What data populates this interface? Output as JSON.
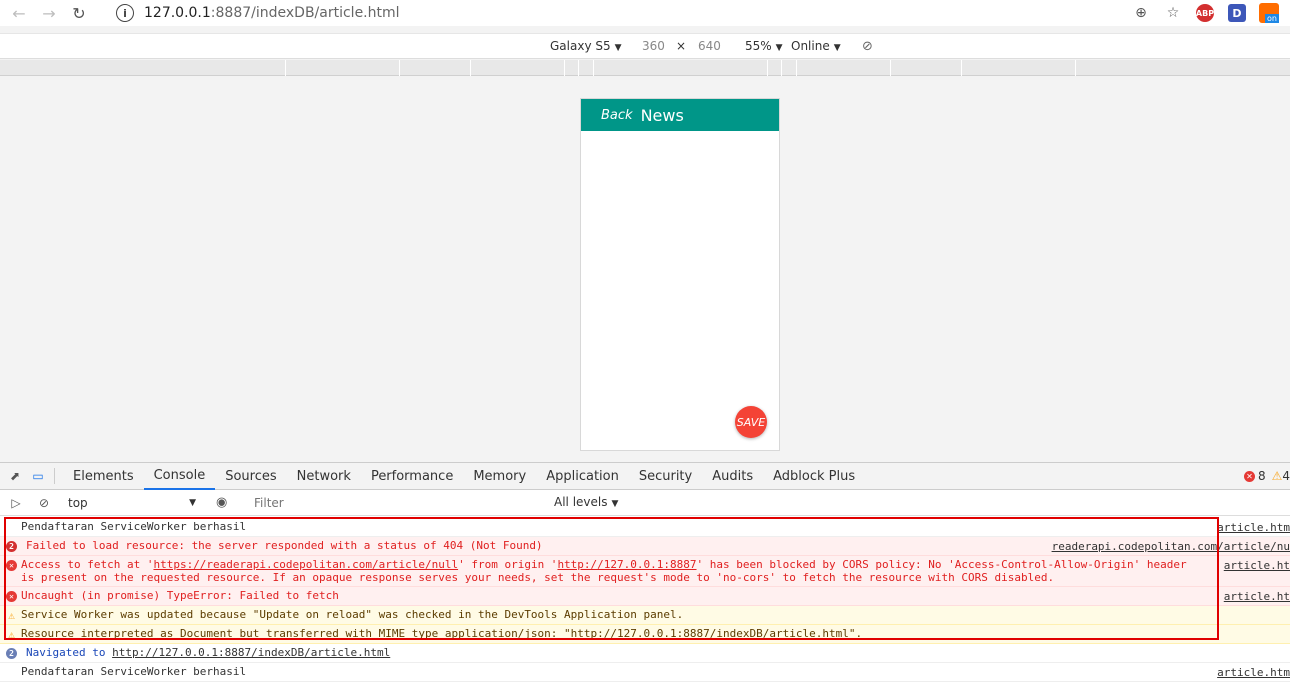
{
  "browser": {
    "url_host": "127.0.0.1",
    "url_rest": ":8887/indexDB/article.html",
    "ext_abp": "ABP",
    "ext_d": "D",
    "ext_on": "on"
  },
  "device_toolbar": {
    "device": "Galaxy S5",
    "width": "360",
    "times": "×",
    "height": "640",
    "zoom": "55%",
    "network": "Online"
  },
  "app": {
    "back_label": "Back",
    "title": "News",
    "fab_label": "SAVE",
    "header_color": "#009688",
    "fab_color": "#f44336"
  },
  "devtools": {
    "tabs": [
      "Elements",
      "Console",
      "Sources",
      "Network",
      "Performance",
      "Memory",
      "Application",
      "Security",
      "Audits",
      "Adblock Plus"
    ],
    "active_tab": "Console",
    "error_count": "8",
    "warn_count": "4",
    "context": "top",
    "filter_placeholder": "Filter",
    "levels": "All levels"
  },
  "console": {
    "m1_text": "Pendaftaran ServiceWorker berhasil",
    "m1_source": "article.htm",
    "m2_count": "2",
    "m2_text": "Failed to load resource: the server responded with a status of 404 (Not Found)",
    "m2_source": "readerapi.codepolitan.com/article/nu",
    "m3_a": "Access to fetch at '",
    "m3_link1": "https://readerapi.codepolitan.com/article/null",
    "m3_b": "' from origin '",
    "m3_link2": "http://127.0.0.1:8887",
    "m3_c": "' has been blocked by CORS policy: No 'Access-Control-Allow-Origin' header is present on the requested resource. If an opaque response serves your needs, set the request's mode to 'no-cors' to fetch the resource with CORS disabled.",
    "m3_source": "article.ht",
    "m4_text": "Uncaught (in promise) TypeError: Failed to fetch",
    "m4_source": "article.ht",
    "m5_text": "Service Worker was updated because \"Update on reload\" was checked in the DevTools Application panel.",
    "m6_text": "Resource interpreted as Document but transferred with MIME type application/json: \"http://127.0.0.1:8887/indexDB/article.html\".",
    "m7_count": "2",
    "m7_text": "Navigated to ",
    "m7_link": "http://127.0.0.1:8887/indexDB/article.html",
    "m8_text": "Pendaftaran ServiceWorker berhasil",
    "m8_source": "article.htm"
  }
}
